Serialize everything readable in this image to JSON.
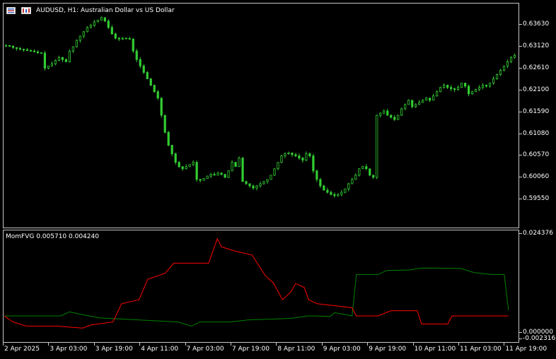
{
  "header": {
    "title": "AUDUSD, H1:  Australian Dollar vs US Dollar",
    "icons": [
      "chart-list-icon",
      "chart-template-icon"
    ]
  },
  "indicator": {
    "label": "MomFVG 0.005710 0.004240"
  },
  "colors": {
    "candle": "#32cd32",
    "bull_line": "#008000",
    "bear_line": "#ff0000",
    "border": "#c8c8c8",
    "text": "#ffffff",
    "background": "#000000"
  },
  "chart_data": [
    {
      "type": "candlestick",
      "symbol": "AUDUSD",
      "timeframe": "H1",
      "y_ticks": [
        "0.63630",
        "0.63120",
        "0.62610",
        "0.62100",
        "0.61590",
        "0.61080",
        "0.60570",
        "0.60060",
        "0.59550"
      ],
      "x_ticks": [
        "2 Apr 2025",
        "3 Apr 03:00",
        "3 Apr 19:00",
        "4 Apr 11:00",
        "7 Apr 03:00",
        "7 Apr 19:00",
        "8 Apr 11:00",
        "9 Apr 03:00",
        "9 Apr 19:00",
        "10 Apr 11:00",
        "11 Apr 03:00",
        "11 Apr 19:00"
      ],
      "ylim": [
        0.5935,
        0.639
      ],
      "close_path": [
        0.6313,
        0.6311,
        0.6308,
        0.6306,
        0.6304,
        0.6303,
        0.6301,
        0.63,
        0.6298,
        0.6296,
        0.6295,
        0.626,
        0.6265,
        0.627,
        0.6278,
        0.6285,
        0.628,
        0.6275,
        0.63,
        0.631,
        0.6325,
        0.6335,
        0.6345,
        0.6355,
        0.636,
        0.6368,
        0.6372,
        0.6378,
        0.637,
        0.6355,
        0.634,
        0.633,
        0.6328,
        0.633,
        0.6329,
        0.6328,
        0.63,
        0.628,
        0.6265,
        0.625,
        0.6235,
        0.622,
        0.6205,
        0.619,
        0.615,
        0.611,
        0.608,
        0.606,
        0.604,
        0.603,
        0.6025,
        0.603,
        0.6035,
        0.604,
        0.6,
        0.5998,
        0.6002,
        0.6008,
        0.6012,
        0.601,
        0.6015,
        0.6012,
        0.6005,
        0.602,
        0.604,
        0.603,
        0.605,
        0.5995,
        0.599,
        0.5985,
        0.598,
        0.5985,
        0.599,
        0.5995,
        0.6,
        0.601,
        0.6025,
        0.604,
        0.6055,
        0.606,
        0.6062,
        0.6058,
        0.6055,
        0.605,
        0.6045,
        0.606,
        0.6055,
        0.602,
        0.6,
        0.5985,
        0.5975,
        0.597,
        0.5965,
        0.5962,
        0.5965,
        0.597,
        0.5978,
        0.599,
        0.6,
        0.601,
        0.6025,
        0.603,
        0.6025,
        0.601,
        0.6005,
        0.615,
        0.6155,
        0.616,
        0.615,
        0.6145,
        0.614,
        0.615,
        0.6165,
        0.6175,
        0.6185,
        0.617,
        0.6175,
        0.618,
        0.6185,
        0.619,
        0.6185,
        0.6195,
        0.6205,
        0.6215,
        0.622,
        0.6215,
        0.6212,
        0.621,
        0.6215,
        0.6225,
        0.6218,
        0.62,
        0.6205,
        0.621,
        0.6215,
        0.622,
        0.6218,
        0.6225,
        0.6235,
        0.6245,
        0.6255,
        0.6265,
        0.6275,
        0.6285,
        0.629
      ]
    },
    {
      "type": "line",
      "name": "MomFVG",
      "y_ticks": [
        "0.024376",
        "0.000000",
        "-0.002316"
      ],
      "ylim": [
        -0.002316,
        0.024376
      ],
      "series": [
        {
          "name": "",
          "color": "#008000",
          "steps": [
            [
              0,
              0.004
            ],
            [
              0.13,
              0.004
            ],
            [
              0.15,
              0.005
            ],
            [
              0.18,
              0.0043
            ],
            [
              0.22,
              0.0035
            ],
            [
              0.4,
              0.0025
            ],
            [
              0.43,
              0.0015
            ],
            [
              0.45,
              0.0025
            ],
            [
              0.52,
              0.0025
            ],
            [
              0.56,
              0.003
            ],
            [
              0.66,
              0.0034
            ],
            [
              0.7,
              0.004
            ],
            [
              0.75,
              0.0039
            ],
            [
              0.76,
              0.0048
            ],
            [
              0.8,
              0.004
            ],
            [
              0.81,
              0.0142
            ],
            [
              0.86,
              0.0142
            ],
            [
              0.88,
              0.0152
            ],
            [
              0.93,
              0.0153
            ],
            [
              0.96,
              0.0158
            ],
            [
              1.05,
              0.0157
            ],
            [
              1.08,
              0.0147
            ],
            [
              1.12,
              0.0142
            ],
            [
              1.15,
              0.0142
            ],
            [
              1.16,
              0.0054
            ]
          ]
        },
        {
          "name": "",
          "color": "#ff0000",
          "steps": [
            [
              0,
              0.004
            ],
            [
              0.02,
              0.0025
            ],
            [
              0.05,
              0.0015
            ],
            [
              0.12,
              0.0015
            ],
            [
              0.18,
              0.001
            ],
            [
              0.2,
              0.0018
            ],
            [
              0.25,
              0.0025
            ],
            [
              0.27,
              0.007
            ],
            [
              0.31,
              0.008
            ],
            [
              0.33,
              0.013
            ],
            [
              0.37,
              0.0145
            ],
            [
              0.39,
              0.017
            ],
            [
              0.47,
              0.017
            ],
            [
              0.49,
              0.023
            ],
            [
              0.5,
              0.021
            ],
            [
              0.53,
              0.02
            ],
            [
              0.57,
              0.019
            ],
            [
              0.6,
              0.014
            ],
            [
              0.62,
              0.012
            ],
            [
              0.64,
              0.008
            ],
            [
              0.66,
              0.01
            ],
            [
              0.67,
              0.012
            ],
            [
              0.69,
              0.011
            ],
            [
              0.7,
              0.008
            ],
            [
              0.72,
              0.007
            ],
            [
              0.8,
              0.006
            ],
            [
              0.81,
              0.004
            ],
            [
              0.86,
              0.004
            ],
            [
              0.89,
              0.0053
            ],
            [
              0.95,
              0.0053
            ],
            [
              0.96,
              0.002
            ],
            [
              1.02,
              0.002
            ],
            [
              1.03,
              0.004
            ],
            [
              1.16,
              0.004
            ]
          ]
        }
      ]
    }
  ]
}
